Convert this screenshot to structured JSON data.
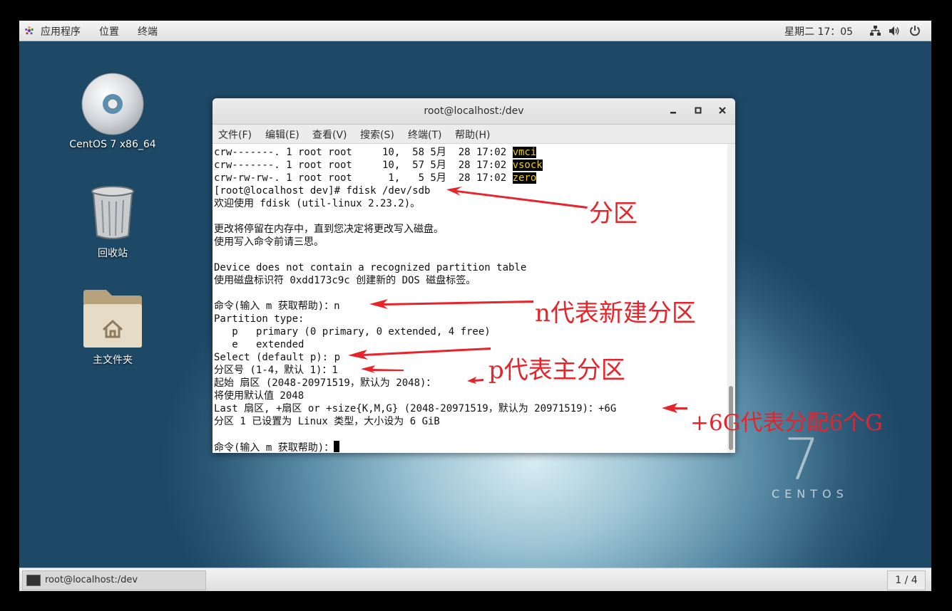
{
  "topbar": {
    "apps": "应用程序",
    "places": "位置",
    "terminal": "终端",
    "clock": "星期二 17：05"
  },
  "desktop": {
    "icons": [
      {
        "label": "CentOS 7 x86_64",
        "icon": "cd-disc-icon"
      },
      {
        "label": "回收站",
        "icon": "trash-icon"
      },
      {
        "label": "主文件夹",
        "icon": "home-folder-icon"
      }
    ],
    "watermark_number": "7",
    "watermark_word": "CENTOS"
  },
  "window": {
    "title": "root@localhost:/dev",
    "menu": [
      "文件(F)",
      "编辑(E)",
      "查看(V)",
      "搜索(S)",
      "终端(T)",
      "帮助(H)"
    ]
  },
  "terminal": {
    "lines": [
      {
        "text": "crw-------. 1 root root     10,  58 5月  28 17:02 ",
        "hl": "vmci"
      },
      {
        "text": "crw-------. 1 root root     10,  57 5月  28 17:02 ",
        "hl": "vsock"
      },
      {
        "text": "crw-rw-rw-. 1 root root      1,   5 5月  28 17:02 ",
        "hl": "zero"
      },
      {
        "text": "[root@localhost dev]# fdisk /dev/sdb"
      },
      {
        "text": "欢迎使用 fdisk (util-linux 2.23.2)。"
      },
      {
        "text": ""
      },
      {
        "text": "更改将停留在内存中，直到您决定将更改写入磁盘。"
      },
      {
        "text": "使用写入命令前请三思。"
      },
      {
        "text": ""
      },
      {
        "text": "Device does not contain a recognized partition table"
      },
      {
        "text": "使用磁盘标识符 0xdd173c9c 创建新的 DOS 磁盘标签。"
      },
      {
        "text": ""
      },
      {
        "text": "命令(输入 m 获取帮助)：n"
      },
      {
        "text": "Partition type:"
      },
      {
        "text": "   p   primary (0 primary, 0 extended, 4 free)"
      },
      {
        "text": "   e   extended"
      },
      {
        "text": "Select (default p): p"
      },
      {
        "text": "分区号 (1-4，默认 1)：1"
      },
      {
        "text": "起始 扇区 (2048-20971519，默认为 2048)："
      },
      {
        "text": "将使用默认值 2048"
      },
      {
        "text": "Last 扇区, +扇区 or +size{K,M,G} (2048-20971519，默认为 20971519)：+6G"
      },
      {
        "text": "分区 1 已设置为 Linux 类型，大小设为 6 GiB"
      },
      {
        "text": ""
      },
      {
        "text": "命令(输入 m 获取帮助)：",
        "cursor": true
      }
    ]
  },
  "annotations": {
    "partition": "分区",
    "new_partition": "n代表新建分区",
    "primary_partition": "p代表主分区",
    "size": "+6G代表分配6个G",
    "color": "#e8232a"
  },
  "taskbar": {
    "task_label": "root@localhost:/dev",
    "workspace": "1 / 4"
  }
}
